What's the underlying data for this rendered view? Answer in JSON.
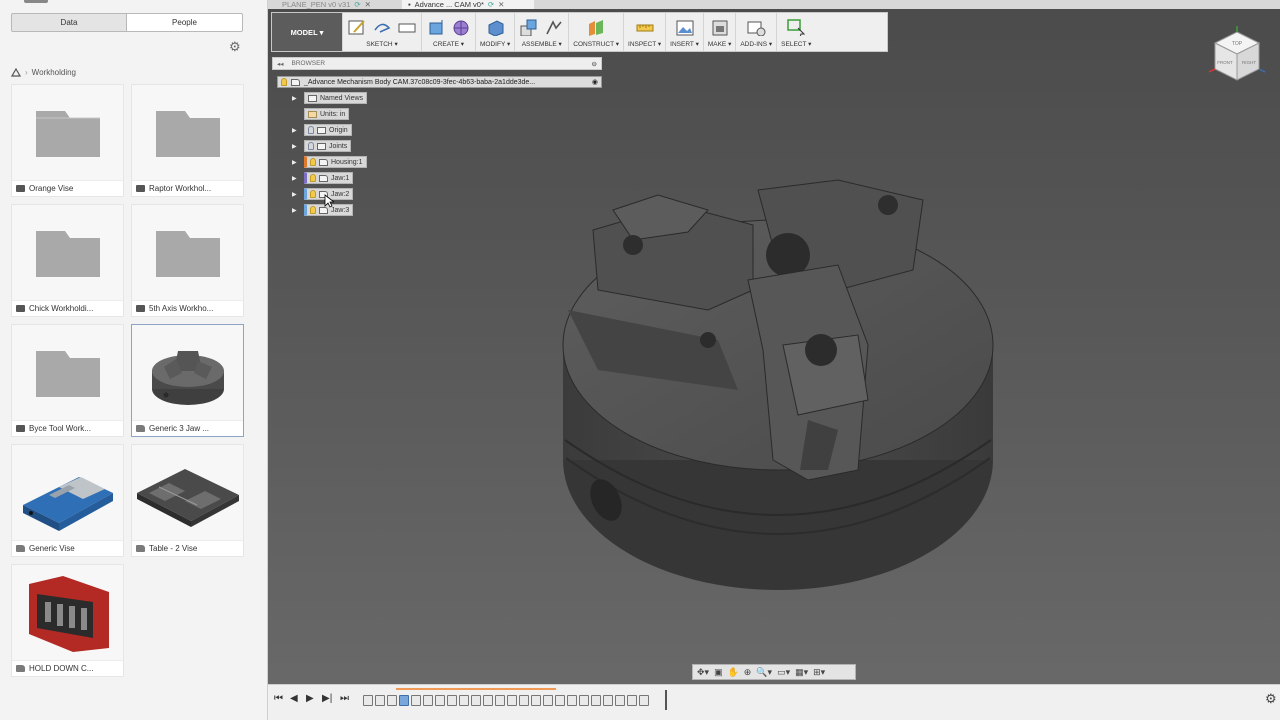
{
  "left_panel": {
    "segments": {
      "data": "Data",
      "people": "People"
    },
    "breadcrumb": {
      "folder": "Workholding"
    },
    "tiles": [
      {
        "label": "Orange Vise",
        "kind": "folder"
      },
      {
        "label": "Raptor Workhol...",
        "kind": "folder"
      },
      {
        "label": "Chick Workholdi...",
        "kind": "folder"
      },
      {
        "label": "5th Axis Workho...",
        "kind": "folder"
      },
      {
        "label": "Byce Tool Work...",
        "kind": "folder"
      },
      {
        "label": "Generic 3 Jaw ...",
        "kind": "design",
        "selected": true
      },
      {
        "label": "Generic Vise",
        "kind": "design"
      },
      {
        "label": "Table - 2 Vise",
        "kind": "design"
      },
      {
        "label": "HOLD DOWN C...",
        "kind": "design"
      }
    ]
  },
  "tabs": [
    {
      "title": "PLANE_PEN v0 v31",
      "active": false
    },
    {
      "title": "Advance ... CAM v0*",
      "active": true
    }
  ],
  "toolbar": {
    "workspace": "MODEL",
    "groups": [
      "SKETCH",
      "CREATE",
      "MODIFY",
      "ASSEMBLE",
      "CONSTRUCT",
      "INSPECT",
      "INSERT",
      "MAKE",
      "ADD-INS",
      "SELECT"
    ]
  },
  "browser": {
    "header": "BROWSER",
    "root": "_Advance Mechanism Body CAM.37c08c09-3fec-4b63-baba-2a1dde3de...",
    "nodes": [
      {
        "label": "Named Views"
      },
      {
        "label": "Units: in"
      },
      {
        "label": "Origin"
      },
      {
        "label": "Joints"
      },
      {
        "label": "Housing:1"
      },
      {
        "label": "Jaw:1"
      },
      {
        "label": "Jaw:2"
      },
      {
        "label": "Jaw:3"
      }
    ]
  },
  "viewcube": {
    "top": "TOP",
    "front": "FRONT",
    "right": "RIGHT"
  },
  "colors": {
    "accent": "#4d9be6",
    "timeline_range": "#f09a55",
    "workspace_bg": "#5c5c5c"
  }
}
